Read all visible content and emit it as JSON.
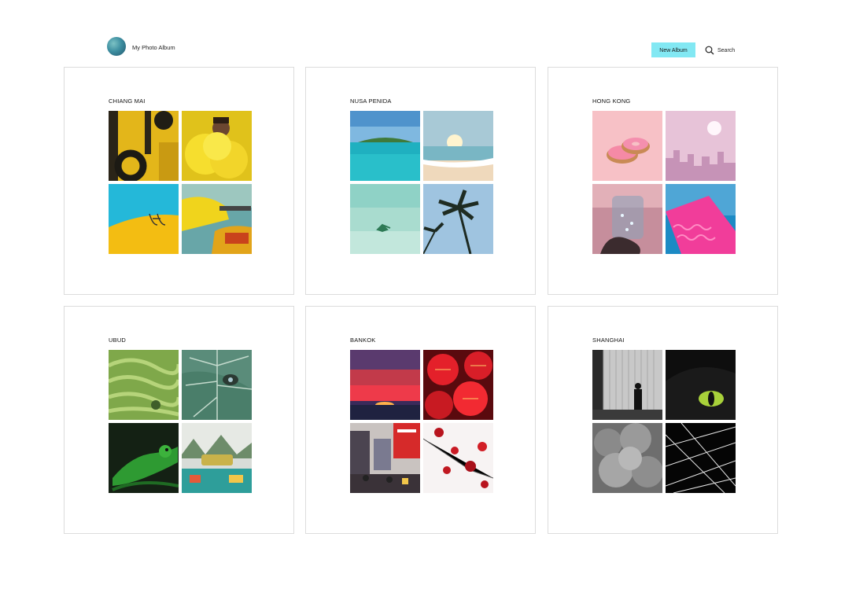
{
  "header": {
    "app_title": "My Photo Album",
    "new_album_label": "New Album",
    "search_label": "Search"
  },
  "albums": [
    {
      "title": "CHIANG MAI"
    },
    {
      "title": "NUSA PENIDA"
    },
    {
      "title": "HONG KONG"
    },
    {
      "title": "UBUD"
    },
    {
      "title": "BANKOK"
    },
    {
      "title": "SHANGHAI"
    }
  ],
  "colors": {
    "accent_button": "#82e8f3",
    "card_border": "#dcdcdc"
  }
}
